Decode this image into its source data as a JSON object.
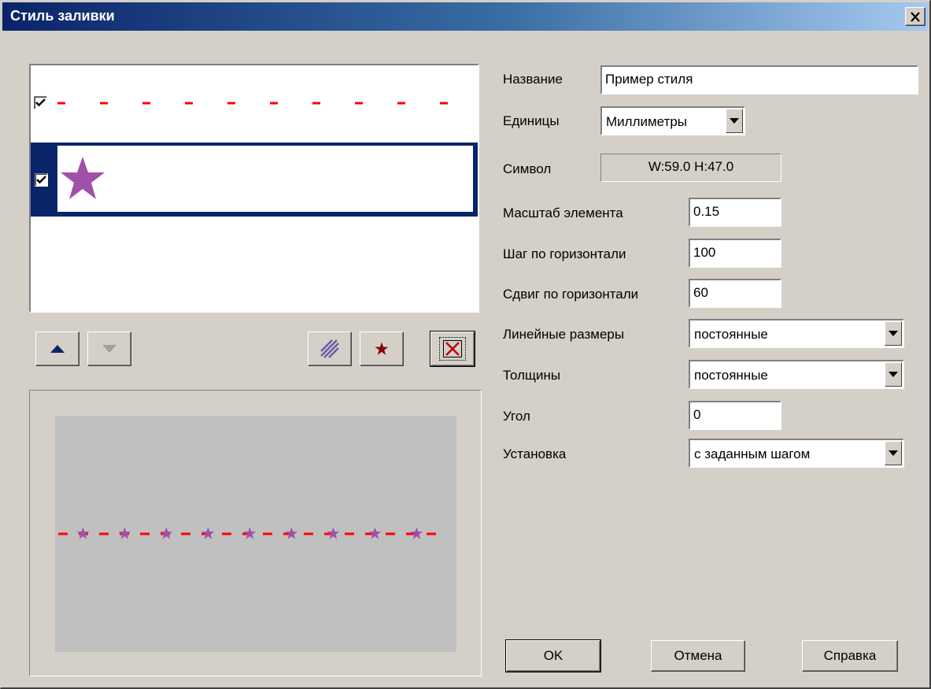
{
  "dialog": {
    "title": "Стиль заливки",
    "close_icon": "close-icon"
  },
  "layers": {
    "items": [
      {
        "checked": true,
        "type": "dashed-line",
        "color": "#ff0000",
        "selected": false
      },
      {
        "checked": true,
        "type": "star-symbol",
        "color": "#a050a8",
        "selected": true
      }
    ]
  },
  "toolbar": {
    "move_up_icon": "arrow-up-icon",
    "move_down_icon": "arrow-down-icon",
    "add_hatch_icon": "hatch-icon",
    "add_symbol_icon": "star-icon",
    "delete_icon": "delete-x-icon"
  },
  "preview": {
    "background": "#c0c0c0",
    "line_color": "#ff0000",
    "star_color": "#a050a8"
  },
  "form": {
    "name_label": "Название",
    "name_value": "Пример стиля",
    "units_label": "Единицы",
    "units_value": "Миллиметры",
    "symbol_label": "Символ",
    "symbol_value": "W:59.0  H:47.0",
    "scale_label": "Масштаб элемента",
    "scale_value": "0.15",
    "hstep_label": "Шаг по горизонтали",
    "hstep_value": "100",
    "hshift_label": "Сдвиг по горизонтали",
    "hshift_value": "60",
    "linear_label": "Линейные размеры",
    "linear_value": "постоянные",
    "thickness_label": "Толщины",
    "thickness_value": "постоянные",
    "angle_label": "Угол",
    "angle_value": "0",
    "placement_label": "Установка",
    "placement_value": "с заданным шагом"
  },
  "buttons": {
    "ok": "OK",
    "cancel": "Отмена",
    "help": "Справка"
  }
}
